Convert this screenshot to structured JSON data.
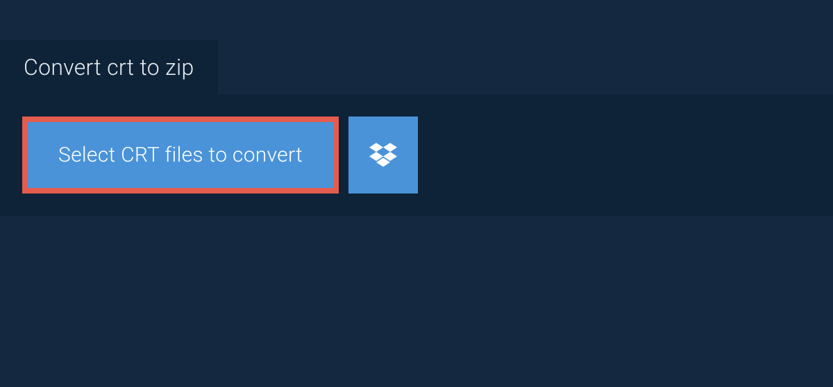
{
  "tab": {
    "title": "Convert crt to zip"
  },
  "actions": {
    "select_label": "Select CRT files to convert"
  },
  "colors": {
    "background": "#14293f",
    "panel": "#0e2338",
    "button": "#4a93d9",
    "highlight_border": "#e45c4e",
    "text_light": "#ffffff"
  }
}
